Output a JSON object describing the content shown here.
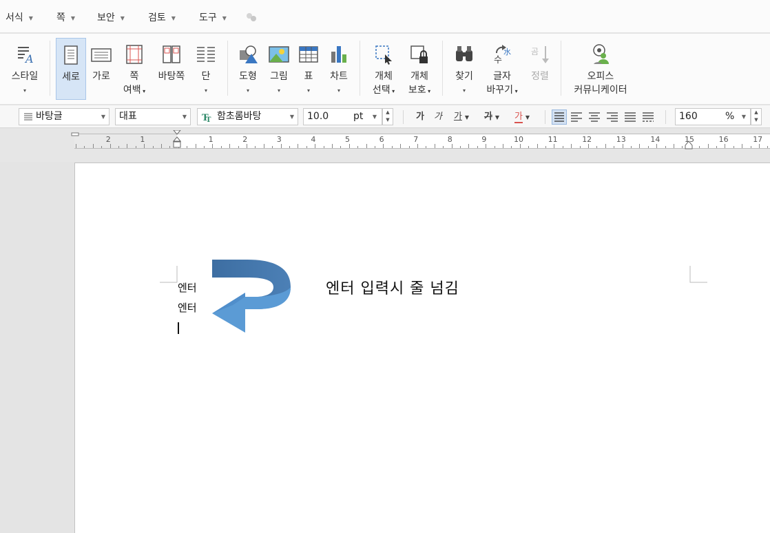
{
  "menu": [
    {
      "label": "서식"
    },
    {
      "label": "쪽"
    },
    {
      "label": "보안"
    },
    {
      "label": "검토"
    },
    {
      "label": "도구"
    }
  ],
  "ribbon": {
    "style": "스타일",
    "portrait": "세로",
    "landscape": "가로",
    "margin_line1": "쪽",
    "margin_line2": "여백",
    "master_page": "바탕쪽",
    "columns": "단",
    "shape": "도형",
    "picture": "그림",
    "table": "표",
    "chart": "차트",
    "select_line1": "개체",
    "select_line2": "선택",
    "protect_line1": "개체",
    "protect_line2": "보호",
    "find": "찾기",
    "replace_line1": "글자",
    "replace_line2": "바꾸기",
    "sort": "정렬",
    "office_line1": "오피스",
    "office_line2": "커뮤니케이터",
    "dropdown_glyph": "▾"
  },
  "format": {
    "style_value": "바탕글",
    "language_value": "대표",
    "font_value": "함초롬바탕",
    "size_value": "10.0",
    "size_unit": "pt",
    "zoom_value": "160",
    "zoom_unit": "%",
    "bold_glyph": "가",
    "italic_glyph": "가",
    "underline_glyph": "가",
    "strike_glyph": "가",
    "color_glyph": "가"
  },
  "ruler": {
    "left_numbers": [
      "2",
      "1"
    ],
    "right_numbers": [
      "1",
      "2",
      "3",
      "4",
      "5",
      "6",
      "7",
      "8",
      "9",
      "10",
      "11",
      "12",
      "13",
      "14",
      "15",
      "16",
      "17"
    ]
  },
  "document": {
    "lines": [
      "엔터",
      "엔터"
    ],
    "annotation": "엔터 입력시 줄 넘김"
  },
  "colors": {
    "arrow_dark": "#4a7db1",
    "arrow_light": "#5b9bd5",
    "active_button": "#d6e5f6"
  }
}
